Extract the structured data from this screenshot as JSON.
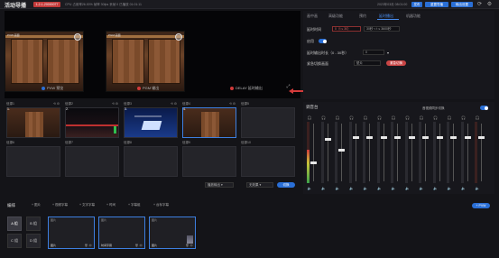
{
  "header": {
    "title": "活动导播",
    "badge": "1-2-1-20000077",
    "status": "CPU 占用率26.00%   帧率 30fps   丢帧 0   已播放 01:01:11",
    "clock": "2023年03月 08:01:00",
    "btn_a": "发布",
    "btn_b": "重置导播",
    "btn_c": "输出设置"
  },
  "preview": {
    "cap_left": "PVW 画面",
    "cap_right": "PGM 画面",
    "pvw_label": "PVW 预览",
    "pgm_label": "PGM 输出",
    "delay_label": "DELAY 延时输出",
    "colors": {
      "pvw": "#2a6fd6",
      "pgm": "#d13a3a",
      "delay": "#d13a3a"
    }
  },
  "settings": {
    "tabs": [
      "画中画",
      "高级功能",
      "预约",
      "延时播出",
      "机器功能"
    ],
    "active_tab": 3,
    "delay_time_label": "延时时间",
    "delay_time_input": "0（t ≤ 30）",
    "delay_time_input2": "30秒 < t ≤ 3600秒",
    "enable_label": "启用",
    "delay_output_label": "延时输出时长（0 - 30秒）",
    "delay_output_value": "0",
    "emergency_label": "紧急切换画面",
    "emergency_value": "垫片",
    "emergency_button": "紧急切换"
  },
  "sources": {
    "items": [
      {
        "label": "信源1",
        "num": "1.",
        "thumb": "door"
      },
      {
        "label": "信源2",
        "num": "2.",
        "thumb": "road"
      },
      {
        "label": "信源3",
        "num": "3.",
        "thumb": "blue",
        "caption": "XXXXXXXXXXXXXXX"
      },
      {
        "label": "信源4",
        "num": "4.",
        "thumb": "door",
        "selected": true
      },
      {
        "label": "信源5",
        "num": "",
        "thumb": ""
      },
      {
        "label": "信源6",
        "num": "",
        "thumb": ""
      },
      {
        "label": "信源7",
        "num": "",
        "thumb": ""
      },
      {
        "label": "信源8",
        "num": "",
        "thumb": ""
      },
      {
        "label": "信源9",
        "num": "",
        "thumb": ""
      },
      {
        "label": "信源10",
        "num": "",
        "thumb": ""
      }
    ],
    "dropdown1": "播放输出",
    "dropdown2": "无效果",
    "switch_button": "切换"
  },
  "mixer": {
    "title": "调音台",
    "sync_label": "音视频同步切换",
    "channels": [
      {
        "level": 0.55,
        "fader": 0.32,
        "hot": true
      },
      {
        "level": 0.0,
        "fader": 0.75,
        "hot": false
      },
      {
        "level": 0.0,
        "fader": 0.55,
        "hot": false
      },
      {
        "level": 0.0,
        "fader": 0.78,
        "hot": false
      },
      {
        "level": 0.0,
        "fader": 0.78,
        "hot": false
      },
      {
        "level": 0.0,
        "fader": 0.78,
        "hot": false
      },
      {
        "level": 0.0,
        "fader": 0.78,
        "hot": false
      },
      {
        "level": 0.0,
        "fader": 0.78,
        "hot": false
      },
      {
        "level": 0.0,
        "fader": 0.78,
        "hot": false
      },
      {
        "level": 0.0,
        "fader": 0.78,
        "hot": false
      },
      {
        "level": 0.0,
        "fader": 0.78,
        "hot": false
      },
      {
        "level": 0.0,
        "fader": 0.78,
        "hot": false
      },
      {
        "level": 0.0,
        "fader": 0.78,
        "hot": true
      }
    ]
  },
  "bottom": {
    "title": "编排",
    "toolbar": [
      "+ 图片",
      "+ 视频字幕",
      "+ 文字字幕",
      "+ 时间",
      "+ 字幕组",
      "+ 台标字幕"
    ],
    "add_button": "+ PVW",
    "groups": [
      "A 组",
      "B 组",
      "C 组",
      "D 组"
    ],
    "active_group": 0,
    "cues": [
      {
        "type": "图片",
        "name": "图片",
        "mini": false
      },
      {
        "type": "图片",
        "name": "时间字幕",
        "mini": false
      },
      {
        "type": "图片",
        "name": "图片",
        "mini": true
      }
    ]
  }
}
